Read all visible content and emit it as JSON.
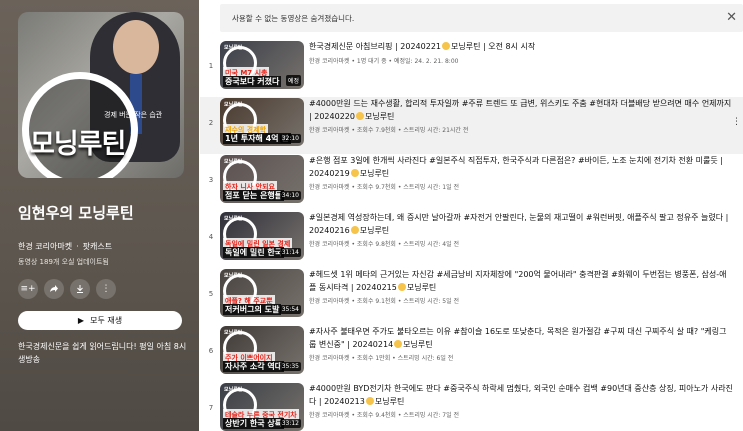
{
  "playlist": {
    "cover_brand": "모닝루틴",
    "cover_sub": "경제 버는 작은 습관",
    "title": "임현우의 모닝루틴",
    "channel": "한경 코리아마켓",
    "type": "팟캐스트",
    "meta": "동영상 189개 오실 업데이트됨",
    "play_all": "모두 재생",
    "description": "한국경제신문을 쉽게 읽어드립니다! 평일 아침 8시 생방송"
  },
  "notice": {
    "text": "사용할 수 없는 동영상은 숨겨졌습니다.",
    "close_icon": "close-icon"
  },
  "videos": [
    {
      "index": "1",
      "title": "한국경제신문 아침브리핑 | 20240221",
      "title_tail": "모닝루틴 | 오전 8시 시작",
      "sub": "한경 코리아마켓 • 1명 대기 중 • 예정일: 24. 2. 21. 8:00",
      "thumb_top": "미국 M7 시총",
      "thumb_bottom": "중국보다 커졌다",
      "duration": "예정",
      "bg": "#3b3f4a",
      "accent": "#e62117"
    },
    {
      "index": "2",
      "title": "#4000만원 드는 재수생활, 합리적 투자일까 #주류 트렌드 또 급변, 위스키도 주춤 #현대차 더블배당 받으려면 매수 언제까지 | 20240220",
      "title_tail": "모닝루틴",
      "sub": "한경 코리아마켓 • 조회수 7.9천회 • 스트리밍 시간: 21시간 전",
      "thumb_top": "재수의 경제학",
      "thumb_bottom": "1년 투자해 4억 번",
      "duration": "32:10",
      "bg": "#4a3a2e",
      "accent": "#f0a500"
    },
    {
      "index": "3",
      "title": "#은행 점포 3일에 한개씩 사라진다 #일본주식 직접투자, 한국주식과 다른점은? #바이든, 노조 눈치에 전기차 전환 미룰듯 | 20240219",
      "title_tail": "모닝루틴",
      "sub": "한경 코리아마켓 • 조회수 9.7천회 • 스트리밍 시간: 1일 전",
      "thumb_top": "하자 니사 안되요",
      "thumb_bottom": "점포 닫는 은행들",
      "duration": "34:10",
      "bg": "#5a5050",
      "accent": "#e62117"
    },
    {
      "index": "4",
      "title": "#일본경제 역성장하는데, 왜 증시만 날아갈까 #자전거 안팔린다, 눈물의 재고떨이 #워런버핏, 애플주식 팔고 정유주 늘렸다 | 20240216",
      "title_tail": "모닝루틴",
      "sub": "한경 코리아마켓 • 조회수 9.8천회 • 스트리밍 시간: 4일 전",
      "thumb_top": "독일에 밀린 일본 경제",
      "thumb_bottom": "독일에 밀린 한국",
      "duration": "31:14",
      "bg": "#2f2f3a",
      "accent": "#e62117"
    },
    {
      "index": "5",
      "title": "#헤드셋 1위 메타의 근거있는 자신감 #세금낭비 지자체장에 \"200억 물어내라\" 충격판결 #화웨이 두번접는 병풍폰, 삼성-애플 동시타격 | 20240215",
      "title_tail": "모닝루틴",
      "sub": "한경 코리아마켓 • 조회수 9.1천회 • 스트리밍 시간: 5일 전",
      "thumb_top": "애플? 해 주교뿐",
      "thumb_bottom": "저커버그의 도발",
      "duration": "35:54",
      "bg": "#4a4440",
      "accent": "#e62117"
    },
    {
      "index": "6",
      "title": "#자사주 불태우면 주가도 불타오르는 이유 #참이슬 16도로 또낮춘다, 목적은 원가절감 #구찌 대신 구찌주식 살 때? \"케링그룹 변신중\" | 20240214",
      "title_tail": "모닝루틴",
      "sub": "한경 코리아마켓 • 조회수 1만회 • 스트리밍 시간: 6일 전",
      "thumb_top": "주가 이쁘어이지",
      "thumb_bottom": "자사주 소각 역대",
      "duration": "35:35",
      "bg": "#3f3a36",
      "accent": "#e62117"
    },
    {
      "index": "7",
      "title": "#4000만원 BYD전기차 한국에도 판다 #중국주식 하락세 멈췄다, 외국인 순매수 컴백 #90년대 중산층 상징, 피아노가 사라진다 | 20240213",
      "title_tail": "모닝루틴",
      "sub": "한경 코리아마켓 • 조회수 9.4천회 • 스트리밍 시간: 7일 전",
      "thumb_top": "테슬라 누른 중국 전기차",
      "thumb_bottom": "상반기 한국 상륙",
      "duration": "33:12",
      "bg": "#3a3e46",
      "accent": "#e62117"
    }
  ],
  "brand_tag": "모닝루틴",
  "colors": {
    "left_panel": "#5e574f",
    "hover_row": "#f1f1f1",
    "notice_bg": "#f2f2f2"
  }
}
